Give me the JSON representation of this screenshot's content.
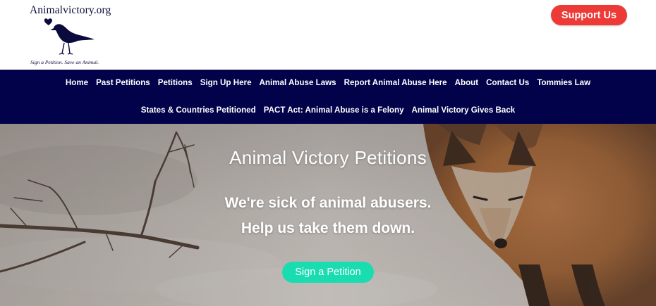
{
  "header": {
    "site_name": "Animalvictory.org",
    "tagline": "Sign a Petition. Save an Animal.",
    "support_label": "Support Us"
  },
  "nav": {
    "row1": [
      "Home",
      "Past Petitions",
      "Petitions",
      "Sign Up Here",
      "Animal Abuse Laws",
      "Report Animal Abuse Here",
      "About",
      "Contact Us",
      "Tommies Law"
    ],
    "row2": [
      "States & Countries Petitioned",
      "PACT Act: Animal Abuse is a Felony",
      "Animal Victory Gives Back"
    ]
  },
  "hero": {
    "title": "Animal Victory Petitions",
    "line1": "We're sick of animal abusers.",
    "line2": "Help us take them down.",
    "cta_label": "Sign a Petition"
  },
  "colors": {
    "brand_navy": "#02024a",
    "support_red": "#ee3a36",
    "cta_teal": "#19dcb0"
  },
  "icons": {
    "logo": "bird-with-heart-icon"
  }
}
